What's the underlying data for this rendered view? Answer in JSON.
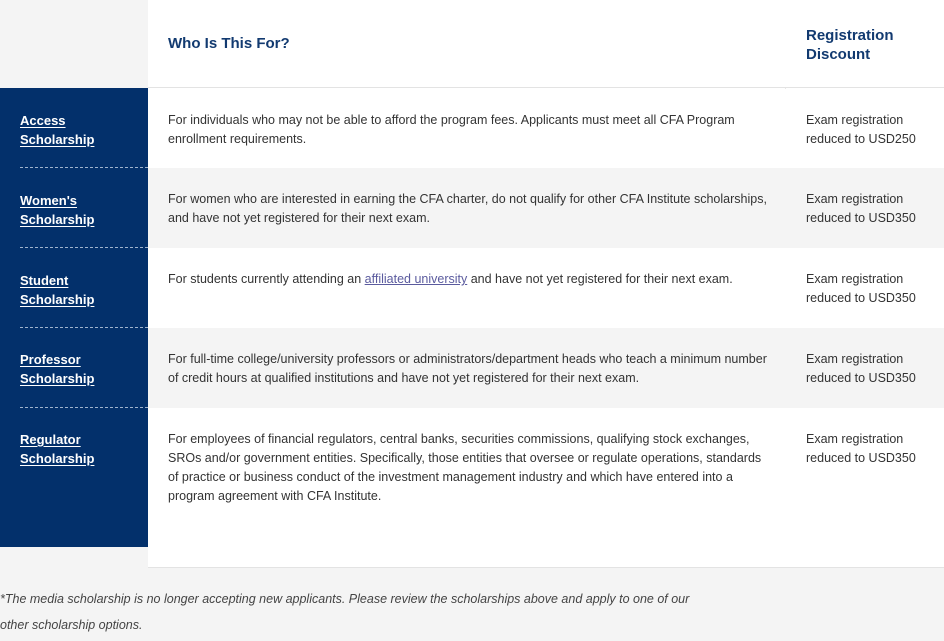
{
  "table": {
    "columns": {
      "scholarship_header": "",
      "who_is_this_for": "Who Is This For?",
      "registration_discount": "Registration Discount"
    },
    "rows": [
      {
        "name": "Access Scholarship",
        "description_pre": "For individuals who may not be able to afford the program fees. Applicants must meet all CFA Program enrollment requirements.",
        "link_text": "",
        "description_post": "",
        "discount": "Exam registration reduced to USD250"
      },
      {
        "name": "Women's Scholarship",
        "description_pre": "For women who are interested in earning the CFA charter, do not qualify for other CFA Institute scholarships, and have not yet registered for their next exam.",
        "link_text": "",
        "description_post": "",
        "discount": "Exam registration reduced to USD350"
      },
      {
        "name": "Student Scholarship",
        "description_pre": "For students currently attending an ",
        "link_text": "affiliated university",
        "description_post": " and have not yet registered for their next exam.",
        "discount": "Exam registration reduced to USD350"
      },
      {
        "name": "Professor Scholarship",
        "description_pre": "For full-time college/university professors or administrators/department heads who teach a minimum number of credit hours at qualified institutions and have not yet registered for their next exam.",
        "link_text": "",
        "description_post": "",
        "discount": "Exam registration reduced to USD350"
      },
      {
        "name": "Regulator Scholarship",
        "description_pre": "For employees of financial regulators, central banks, securities commissions, qualifying stock exchanges, SROs and/or government entities. Specifically, those entities that oversee or regulate operations, standards of practice or business conduct of the investment management industry and which have entered into a program agreement with CFA Institute.",
        "link_text": "",
        "description_post": "",
        "discount": "Exam registration reduced to USD350"
      }
    ]
  },
  "footnote": "*The media scholarship is no longer accepting new applicants. Please review the scholarships above and apply to one of our other scholarship options.",
  "colors": {
    "sidebar_navy": "#03306b",
    "header_text_navy": "#123a70",
    "row_alt_background": "#f4f4f4",
    "page_background": "#f4f4f4",
    "link_purple": "#5b5b9e",
    "dashed_separator": "#9fb3cd"
  }
}
